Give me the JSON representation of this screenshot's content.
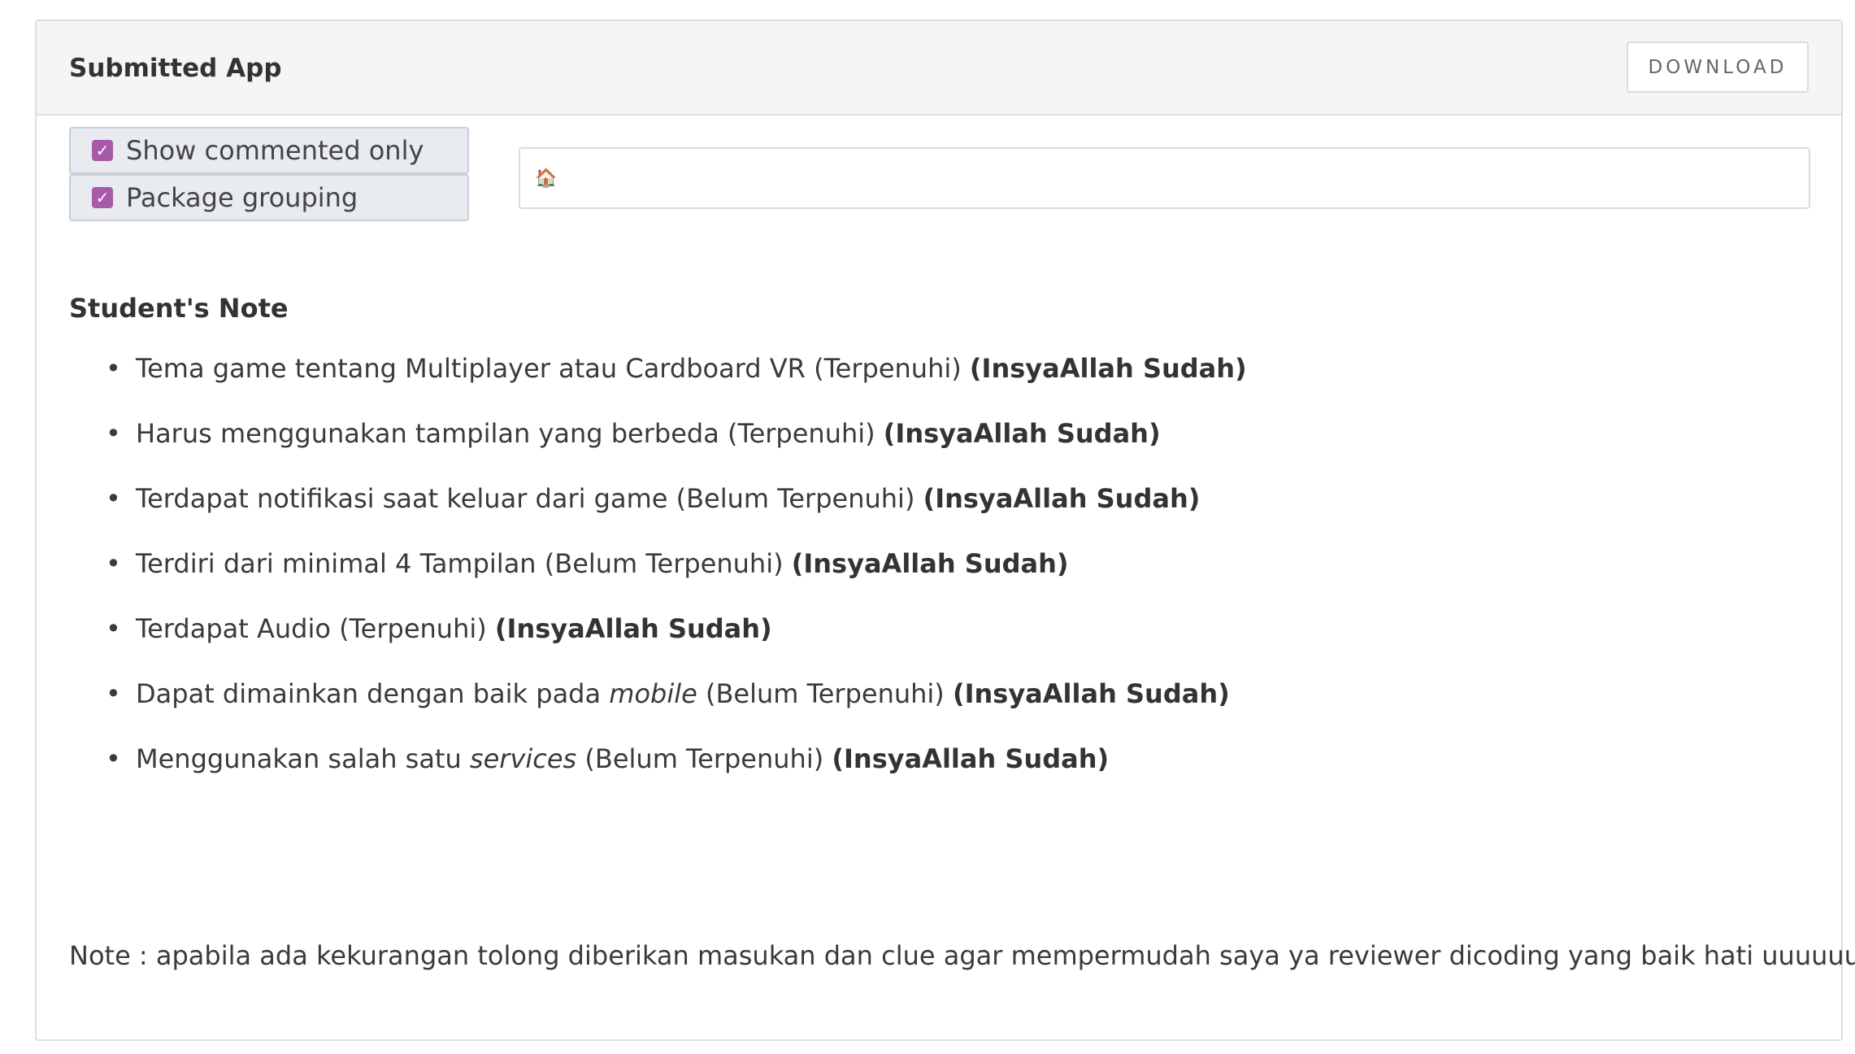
{
  "card": {
    "title": "Submitted App",
    "download_label": "DOWNLOAD"
  },
  "filters": {
    "show_commented_only": {
      "label": "Show commented only",
      "checked": true
    },
    "package_grouping": {
      "label": "Package grouping",
      "checked": true
    }
  },
  "path": {
    "icon": "home-icon",
    "icon_glyph": "🏠"
  },
  "student_note": {
    "heading": "Student's Note",
    "items": [
      {
        "before": "Tema game tentang Multiplayer atau Cardboard VR (Terpenuhi) ",
        "em": "",
        "after": "",
        "strong": "(InsyaAllah Sudah)"
      },
      {
        "before": "Harus menggunakan tampilan yang berbeda (Terpenuhi) ",
        "em": "",
        "after": "",
        "strong": "(InsyaAllah Sudah)"
      },
      {
        "before": "Terdapat notifikasi saat keluar dari game (Belum Terpenuhi) ",
        "em": "",
        "after": "",
        "strong": "(InsyaAllah Sudah)"
      },
      {
        "before": "Terdiri dari minimal 4 Tampilan (Belum Terpenuhi) ",
        "em": "",
        "after": "",
        "strong": "(InsyaAllah Sudah)"
      },
      {
        "before": "Terdapat Audio (Terpenuhi) ",
        "em": "",
        "after": "",
        "strong": "(InsyaAllah Sudah)"
      },
      {
        "before": "Dapat dimainkan dengan baik pada ",
        "em": "mobile",
        "after": " (Belum Terpenuhi) ",
        "strong": "(InsyaAllah Sudah)"
      },
      {
        "before": "Menggunakan salah satu ",
        "em": "services",
        "after": " (Belum Terpenuhi) ",
        "strong": "(InsyaAllah Sudah)"
      }
    ],
    "footer": "Note :  apabila ada kekurangan tolong diberikan masukan dan clue agar mempermudah saya ya reviewer dicoding yang baik hati uuuuuu."
  },
  "colors": {
    "checkbox_accent": "#a65aa8",
    "header_bg": "#f5f5f5",
    "border": "#dedede"
  }
}
